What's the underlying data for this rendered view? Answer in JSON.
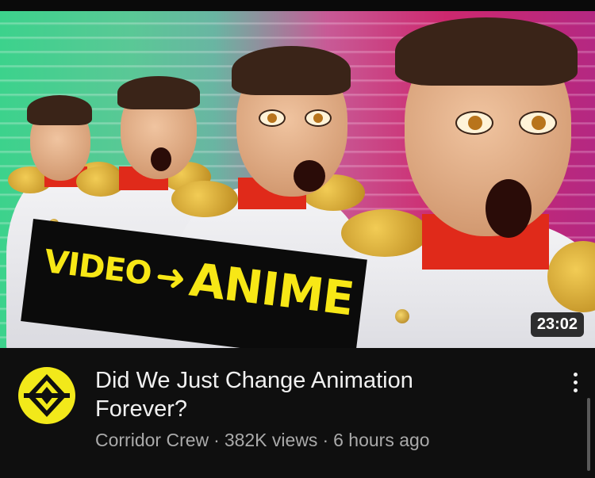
{
  "thumbnail": {
    "banner_left": "VIDEO",
    "banner_arrow": "➜",
    "banner_right": "ANIME",
    "duration": "23:02"
  },
  "video": {
    "title": "Did We Just Change Animation Forever?",
    "channel": "Corridor Crew",
    "separator": "·",
    "views": "382K views",
    "age": "6 hours ago"
  },
  "channel_logo": {
    "bg_color": "#f2e91a",
    "mark_color": "#0f0f0f"
  },
  "icons": {
    "menu": "more-vert-icon",
    "logo": "corridor-logo-icon"
  },
  "colors": {
    "background": "#0f0f0f",
    "text_primary": "#f1f1f1",
    "text_secondary": "#aaaaaa",
    "banner_text": "#f7e716"
  }
}
